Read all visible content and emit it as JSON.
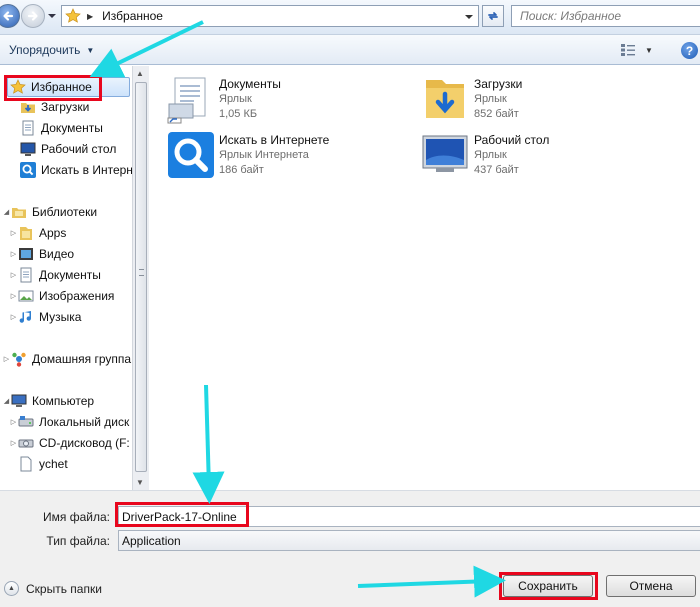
{
  "address_bar": {
    "location": "Избранное",
    "search_placeholder": "Поиск: Избранное"
  },
  "toolbar": {
    "organize_label": "Упорядочить",
    "help_label": "?"
  },
  "nav_pane": {
    "favorites": {
      "label": "Избранное",
      "items": [
        "Загрузки",
        "Документы",
        "Рабочий стол",
        "Искать в Интернете"
      ]
    },
    "libraries": {
      "label": "Библиотеки",
      "items": [
        "Apps",
        "Видео",
        "Документы",
        "Изображения",
        "Музыка"
      ]
    },
    "homegroup": {
      "label": "Домашняя группа"
    },
    "computer": {
      "label": "Компьютер",
      "items": [
        "Локальный диск",
        "CD-дисковод (F:",
        "ychet"
      ]
    }
  },
  "files": [
    {
      "name": "Документы",
      "type": "Ярлык",
      "size": "1,05 КБ",
      "icon": "documents-shortcut-icon"
    },
    {
      "name": "Загрузки",
      "type": "Ярлык",
      "size": "852 байт",
      "icon": "downloads-folder-icon"
    },
    {
      "name": "Искать в Интернете",
      "type": "Ярлык Интернета",
      "size": "186 байт",
      "icon": "search-internet-icon"
    },
    {
      "name": "Рабочий стол",
      "type": "Ярлык",
      "size": "437 байт",
      "icon": "desktop-icon"
    }
  ],
  "form": {
    "filename_label": "Имя файла:",
    "filename_value": "DriverPack-17-Online",
    "filetype_label": "Тип файла:",
    "filetype_value": "Application",
    "hide_folders_label": "Скрыть папки",
    "save_label": "Сохранить",
    "cancel_label": "Отмена"
  },
  "colors": {
    "highlight_box": "#e8061d",
    "annotation_arrow": "#1fd8e3",
    "selection_bg": "#cde3fb"
  }
}
